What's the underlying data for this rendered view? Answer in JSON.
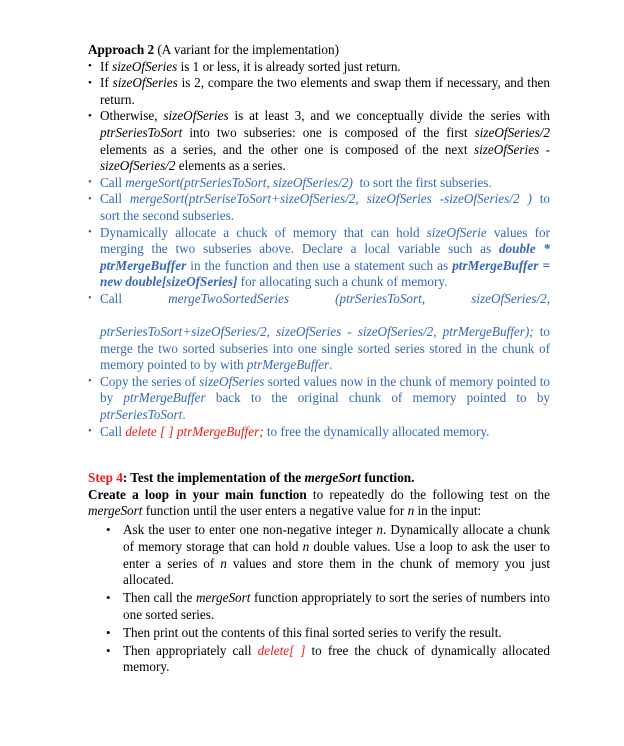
{
  "document": {
    "page_background": "#ffffff",
    "text_color": "#000000",
    "accent_blue": "#3569b4",
    "accent_red": "#ee1b17"
  },
  "approach": {
    "title_bold": "Approach 2",
    "title_rest": " (A variant for the implementation)",
    "bullets": [
      {
        "color": "black",
        "segments": [
          {
            "text": "If ",
            "style": "normal"
          },
          {
            "text": "sizeOfSeries",
            "style": "italic"
          },
          {
            "text": " is 1 or less, it is already sorted just return.",
            "style": "normal"
          }
        ]
      },
      {
        "color": "black",
        "segments": [
          {
            "text": "If ",
            "style": "normal"
          },
          {
            "text": "sizeOfSeries",
            "style": "italic"
          },
          {
            "text": " is 2, compare the two elements and swap them if necessary, and then return.",
            "style": "normal"
          }
        ]
      },
      {
        "color": "black",
        "segments": [
          {
            "text": "Otherwise, ",
            "style": "normal"
          },
          {
            "text": "sizeOfSeries",
            "style": "italic"
          },
          {
            "text": " is at least 3, and we conceptually divide the series with ",
            "style": "normal"
          },
          {
            "text": "ptrSeriesToSort",
            "style": "italic"
          },
          {
            "text": " into two subseries: one is composed of the first ",
            "style": "normal"
          },
          {
            "text": "sizeOfSeries/2",
            "style": "italic"
          },
          {
            "text": " elements as a series, and the other one is composed of the next ",
            "style": "normal"
          },
          {
            "text": "sizeOfSeries - sizeOfSeries/2",
            "style": "italic"
          },
          {
            "text": " elements as a series.",
            "style": "normal"
          }
        ]
      },
      {
        "color": "blue",
        "segments": [
          {
            "text": "Call ",
            "style": "normal"
          },
          {
            "text": "mergeSort(ptrSeriesToSort, sizeOfSeries/2)",
            "style": "italic"
          },
          {
            "text": "  to sort the first subseries.",
            "style": "normal"
          }
        ]
      },
      {
        "color": "blue",
        "segments": [
          {
            "text": "Call ",
            "style": "normal"
          },
          {
            "text": "mergeSort(ptrSeriseToSort+sizeOfSeries/2, sizeOfSeries -sizeOfSeries/2 )",
            "style": "italic"
          },
          {
            "text": " to sort the second subseries.",
            "style": "normal"
          }
        ]
      },
      {
        "color": "blue",
        "segments": [
          {
            "text": "Dynamically allocate a chuck of memory that can hold ",
            "style": "normal"
          },
          {
            "text": "sizeOfSerie",
            "style": "italic"
          },
          {
            "text": " values for merging the two subseries above. Declare a local variable such as ",
            "style": "normal"
          },
          {
            "text": "double * ptrMergeBuffer",
            "style": "bold-italic"
          },
          {
            "text": " in the function and then use a statement such as ",
            "style": "normal"
          },
          {
            "text": "ptrMergeBuffer = new double[sizeOfSeries]",
            "style": "bold-italic"
          },
          {
            "text": " for allocating such a chunk of memory.",
            "style": "normal"
          }
        ]
      },
      {
        "color": "blue",
        "call_label": "Call",
        "call_name": "mergeTwoSortedSeries",
        "call_args_first": "(ptrSeriesToSort,",
        "call_args_second": "sizeOfSeries/2,",
        "segments": [
          {
            "text": "ptrSeriesToSort+sizeOfSeries/2, sizeOfSeries - sizeOfSeries/2, ptrMergeBuffer);",
            "style": "italic"
          },
          {
            "text": " to merge  the two sorted subseries into one single sorted series stored in the chunk of memory pointed to by with ",
            "style": "normal"
          },
          {
            "text": "ptrMergeBuffer",
            "style": "italic"
          },
          {
            "text": ".",
            "style": "normal"
          }
        ]
      },
      {
        "color": "blue",
        "segments": [
          {
            "text": "Copy the series of ",
            "style": "normal"
          },
          {
            "text": "sizeOfSeries",
            "style": "italic"
          },
          {
            "text": " sorted values now in the chunk of memory pointed to by ",
            "style": "normal"
          },
          {
            "text": "ptrMergeBuffer",
            "style": "italic"
          },
          {
            "text": " back to the original chunk of memory pointed to by ",
            "style": "normal"
          },
          {
            "text": "ptrSeriesToSort",
            "style": "italic"
          },
          {
            "text": ".",
            "style": "normal"
          }
        ]
      },
      {
        "color": "blue",
        "segments": [
          {
            "text": "Call ",
            "style": "normal"
          },
          {
            "text": "delete [ ] ptrMergeBuffer;",
            "style": "italic-red"
          },
          {
            "text": " to free the dynamically allocated memory.",
            "style": "normal"
          }
        ]
      }
    ]
  },
  "step4": {
    "label": "Step 4",
    "label_color": "#ee1b17",
    "heading_rest_before_italic": ": Test the implementation of the ",
    "heading_italic": "mergeSort",
    "heading_rest_after_italic": " function.",
    "intro_bold": "Create a loop in your main function",
    "intro_normal_1": " to repeatedly do the following test on the ",
    "intro_italic_1": "mergeSort",
    "intro_normal_2": " function until the user enters a negative value for ",
    "intro_italic_2": "n",
    "intro_normal_3": " in the input:",
    "bullets": [
      {
        "segments": [
          {
            "text": "Ask the user to enter one non-negative integer ",
            "style": "normal"
          },
          {
            "text": "n",
            "style": "italic"
          },
          {
            "text": ". Dynamically allocate a chunk of memory storage that can hold ",
            "style": "normal"
          },
          {
            "text": "n",
            "style": "italic"
          },
          {
            "text": " double values. Use a loop to ask the user to enter a series of ",
            "style": "normal"
          },
          {
            "text": "n",
            "style": "italic"
          },
          {
            "text": " values and store them in the chunk of memory you just allocated.",
            "style": "normal"
          }
        ]
      },
      {
        "segments": [
          {
            "text": "Then call the ",
            "style": "normal"
          },
          {
            "text": "mergeSort",
            "style": "italic"
          },
          {
            "text": " function appropriately to sort the series of numbers into one sorted series.",
            "style": "normal"
          }
        ]
      },
      {
        "segments": [
          {
            "text": "Then print out the contents of this final sorted series to verify the result.",
            "style": "normal"
          }
        ]
      },
      {
        "segments": [
          {
            "text": "Then appropriately call ",
            "style": "normal"
          },
          {
            "text": "delete[ ]",
            "style": "italic-red"
          },
          {
            "text": " to free the chuck of dynamically allocated memory.",
            "style": "normal"
          }
        ]
      }
    ]
  }
}
